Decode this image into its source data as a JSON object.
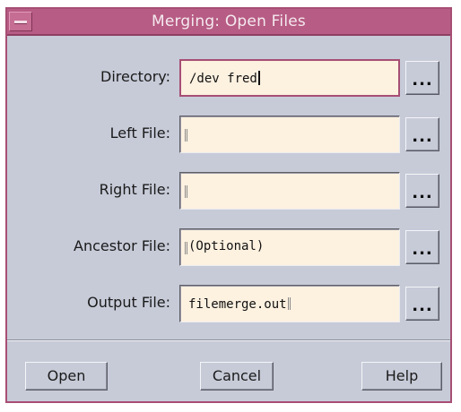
{
  "window": {
    "title": "Merging: Open Files"
  },
  "rows": [
    {
      "label": "Directory:",
      "value": "/dev fred",
      "browse": "..."
    },
    {
      "label": "Left File:",
      "value": "",
      "browse": "..."
    },
    {
      "label": "Right File:",
      "value": "",
      "browse": "..."
    },
    {
      "label": "Ancestor File:",
      "value": "(Optional)",
      "browse": "..."
    },
    {
      "label": "Output File:",
      "value": "filemerge.out",
      "browse": "..."
    }
  ],
  "buttons": {
    "open": "Open",
    "cancel": "Cancel",
    "help": "Help"
  },
  "colors": {
    "titlebar": "#b75c84",
    "dialog_bg": "#c7cbd8",
    "field_bg": "#fdf1e0"
  }
}
